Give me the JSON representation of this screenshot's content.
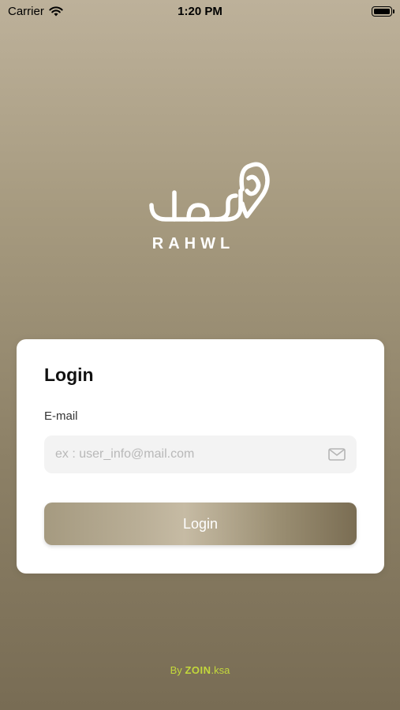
{
  "status_bar": {
    "carrier": "Carrier",
    "time": "1:20 PM"
  },
  "logo": {
    "arabic": "رحول",
    "wordmark": "RAHWL"
  },
  "login_card": {
    "title": "Login",
    "email_label": "E-mail",
    "email_value": "",
    "email_placeholder": "ex : user_info@mail.com",
    "submit_label": "Login"
  },
  "footer": {
    "by": "By",
    "brand": "ZOIN",
    "suffix": ".ksa"
  },
  "colors": {
    "accent_gold": "#b9ae96",
    "footer_green": "#c3d83b"
  },
  "icons": {
    "wifi": "wifi-icon",
    "battery": "battery-icon",
    "mail": "mail-icon"
  }
}
